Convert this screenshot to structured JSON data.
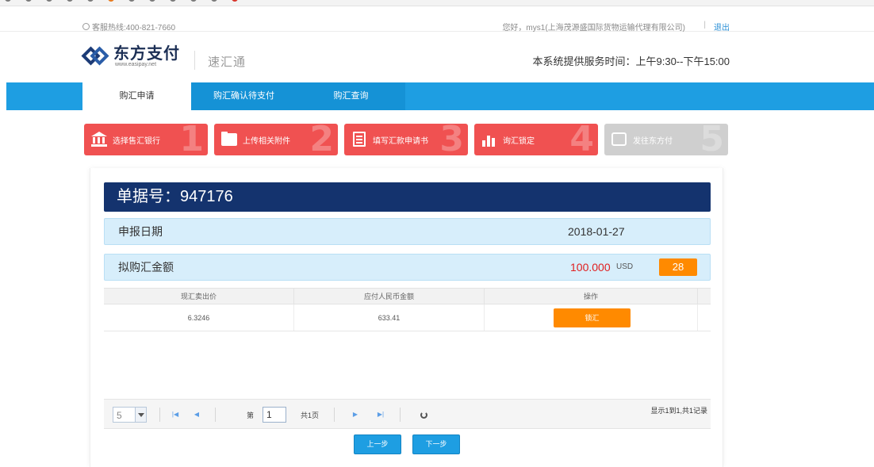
{
  "topbar": {
    "hotline": "客服热线:400-821-7660",
    "welcome": "您好，mys1(上海茂源盛国际货物运输代理有限公司)",
    "separator": "|",
    "logout": "退出"
  },
  "header": {
    "logo_cn": "东方支付",
    "logo_en": "www.easipay.net",
    "product_name": "速汇通",
    "service_time": "本系统提供服务时间：上午9:30--下午15:00"
  },
  "nav": {
    "tabs": [
      {
        "label": "购汇申请"
      },
      {
        "label": "购汇确认待支付"
      },
      {
        "label": "购汇查询"
      }
    ]
  },
  "steps": [
    {
      "label": "选择售汇银行",
      "num": "1",
      "icon": "bank-icon"
    },
    {
      "label": "上传相关附件",
      "num": "2",
      "icon": "folder-icon"
    },
    {
      "label": "填写汇款申请书",
      "num": "3",
      "icon": "form-icon"
    },
    {
      "label": "询汇锁定",
      "num": "4",
      "icon": "chart-lock-icon"
    },
    {
      "label": "发往东方付",
      "num": "5",
      "icon": "send-icon"
    }
  ],
  "document": {
    "title": "单据号：947176",
    "date_label": "申报日期",
    "date_value": "2018-01-27",
    "amount_label": "拟购汇金额",
    "amount_value": "100.000",
    "amount_currency": "USD",
    "amount_badge": "28"
  },
  "table": {
    "headers": [
      "现汇卖出价",
      "应付人民币金额",
      "操作"
    ],
    "rows": [
      {
        "rate": "6.3246",
        "rmb": "633.41",
        "action": "锁汇"
      }
    ]
  },
  "pager": {
    "page_size": "5",
    "page_prefix": "第",
    "current_page": "1",
    "total_pages": "共1页",
    "info": "显示1到1,共1记录"
  },
  "buttons": {
    "prev": "上一步",
    "next": "下一步"
  },
  "colors": {
    "nav_blue": "#1e9ee2",
    "step_red": "#f05151",
    "title_navy": "#14336e",
    "accent_orange": "#ff8a00"
  }
}
